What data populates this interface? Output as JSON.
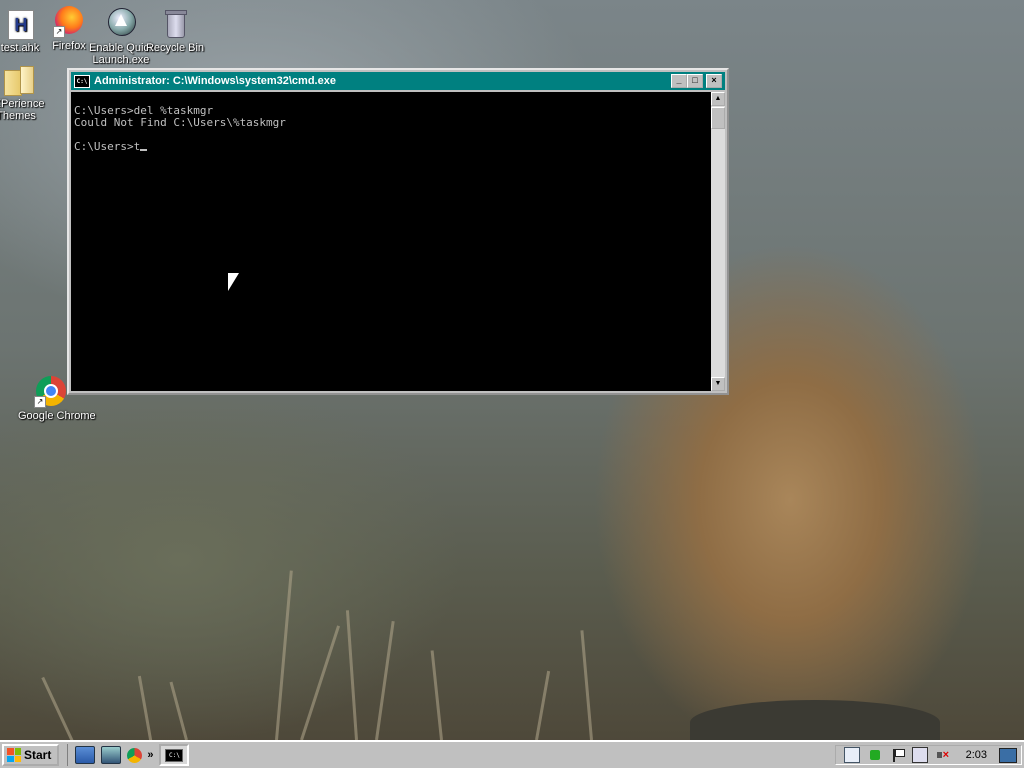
{
  "desktop_icons": [
    {
      "id": "test-ahk",
      "label": "test.ahk"
    },
    {
      "id": "firefox",
      "label": "Firefox"
    },
    {
      "id": "enable-quick-launch",
      "label": "Enable Quick\nLaunch.exe"
    },
    {
      "id": "recycle-bin",
      "label": "Recycle Bin"
    },
    {
      "id": "experience-themes",
      "label": "eXPerience\nThemes"
    },
    {
      "id": "google-chrome",
      "label": "Google Chrome"
    }
  ],
  "cmd_window": {
    "title": "Administrator: C:\\Windows\\system32\\cmd.exe",
    "icon_text": "C:\\",
    "lines": [
      "C:\\Users>del %taskmgr",
      "Could Not Find C:\\Users\\%taskmgr",
      "",
      "C:\\Users>t"
    ],
    "buttons": {
      "minimize": "_",
      "maximize": "□",
      "close": "×"
    }
  },
  "taskbar": {
    "start_label": "Start",
    "chevron": "»",
    "task_icon_text": "C:\\",
    "clock": "2:03"
  },
  "colors": {
    "titlebar": "#008080",
    "console_bg": "#000000",
    "console_fg": "#c0c0c0",
    "taskbar": "#c0c0c0"
  }
}
